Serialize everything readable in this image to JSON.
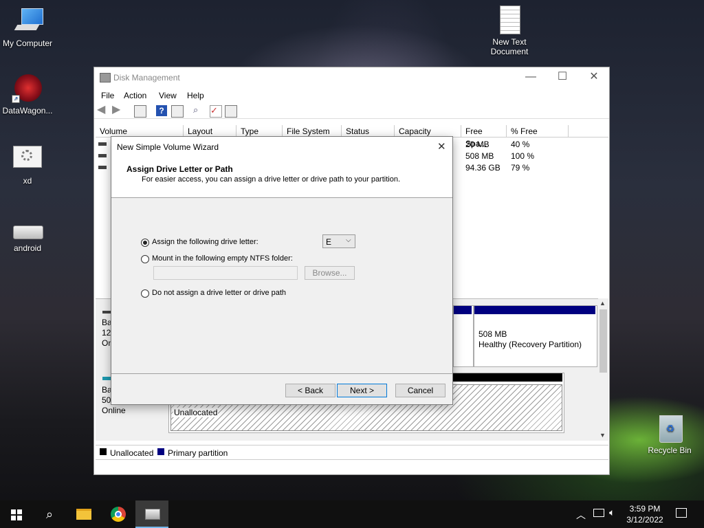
{
  "desktop": {
    "icons": [
      {
        "label": "My Computer",
        "icon": "computer-icon"
      },
      {
        "label": "DataWagon...",
        "icon": "datawagon-icon"
      },
      {
        "label": "xd",
        "icon": "settings-file-icon"
      },
      {
        "label": "android",
        "icon": "drive-icon"
      },
      {
        "label": "New Text Document",
        "icon": "text-document-icon"
      },
      {
        "label": "Recycle Bin",
        "icon": "recycle-bin-icon"
      }
    ]
  },
  "disk_management": {
    "title": "Disk Management",
    "menu": [
      "File",
      "Action",
      "View",
      "Help"
    ],
    "columns": [
      "Volume",
      "Layout",
      "Type",
      "File System",
      "Status",
      "Capacity",
      "Free Spa...",
      "% Free"
    ],
    "rows": [
      {
        "free": "20 MB",
        "pct": "40 %"
      },
      {
        "free": "508 MB",
        "pct": "100 %"
      },
      {
        "free": "94.36 GB",
        "pct": "79 %"
      }
    ],
    "disk0": {
      "line1": "Bas",
      "line2": "120",
      "line3": "Onl"
    },
    "disk1": {
      "line1": "Bas",
      "line2": "50.",
      "line3": "Online"
    },
    "partition_recovery": {
      "size": "508 MB",
      "status": "Healthy (Recovery Partition)"
    },
    "unallocated_label": "Unallocated",
    "legend": [
      {
        "label": "Unallocated",
        "color": "#000000"
      },
      {
        "label": "Primary partition",
        "color": "#000080"
      }
    ]
  },
  "wizard": {
    "title": "New Simple Volume Wizard",
    "heading": "Assign Drive Letter or Path",
    "subheading": "For easier access, you can assign a drive letter or drive path to your partition.",
    "option_letter": "Assign the following drive letter:",
    "drive_letter": "E",
    "option_folder": "Mount in the following empty NTFS folder:",
    "browse": "Browse...",
    "option_none": "Do not assign a drive letter or drive path",
    "back": "< Back",
    "next": "Next >",
    "cancel": "Cancel"
  },
  "taskbar": {
    "time": "3:59 PM",
    "date": "3/12/2022"
  }
}
